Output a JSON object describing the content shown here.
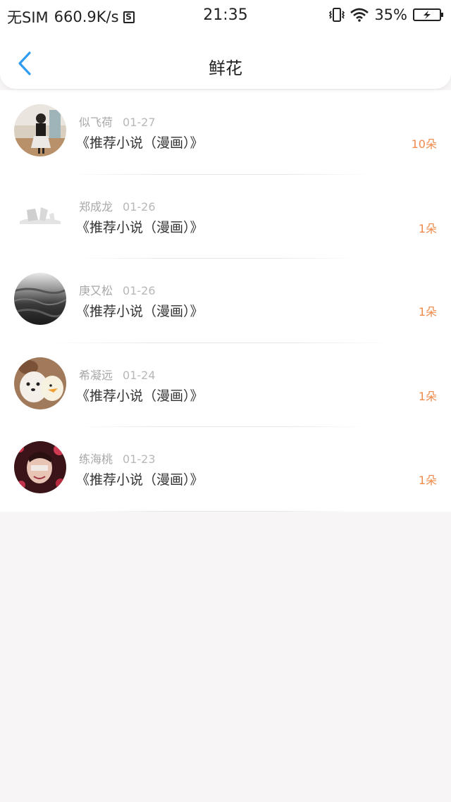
{
  "status_bar": {
    "carrier": "无SIM",
    "speed": "660.9K/s",
    "s_icon": "S",
    "time": "21:35",
    "battery": "35%"
  },
  "nav": {
    "title": "鲜花"
  },
  "colors": {
    "accent_blue": "#2f9cf0",
    "count_orange": "#f08a4b"
  },
  "items": [
    {
      "name": "似飞荷",
      "date": "01-27",
      "title": "《推荐小说（漫画）》",
      "count": "10朵"
    },
    {
      "name": "郑成龙",
      "date": "01-26",
      "title": "《推荐小说（漫画）》",
      "count": "1朵"
    },
    {
      "name": "庚又松",
      "date": "01-26",
      "title": "《推荐小说（漫画）》",
      "count": "1朵"
    },
    {
      "name": "希凝远",
      "date": "01-24",
      "title": "《推荐小说（漫画）》",
      "count": "1朵"
    },
    {
      "name": "练海桃",
      "date": "01-23",
      "title": "《推荐小说（漫画）》",
      "count": "1朵"
    }
  ]
}
